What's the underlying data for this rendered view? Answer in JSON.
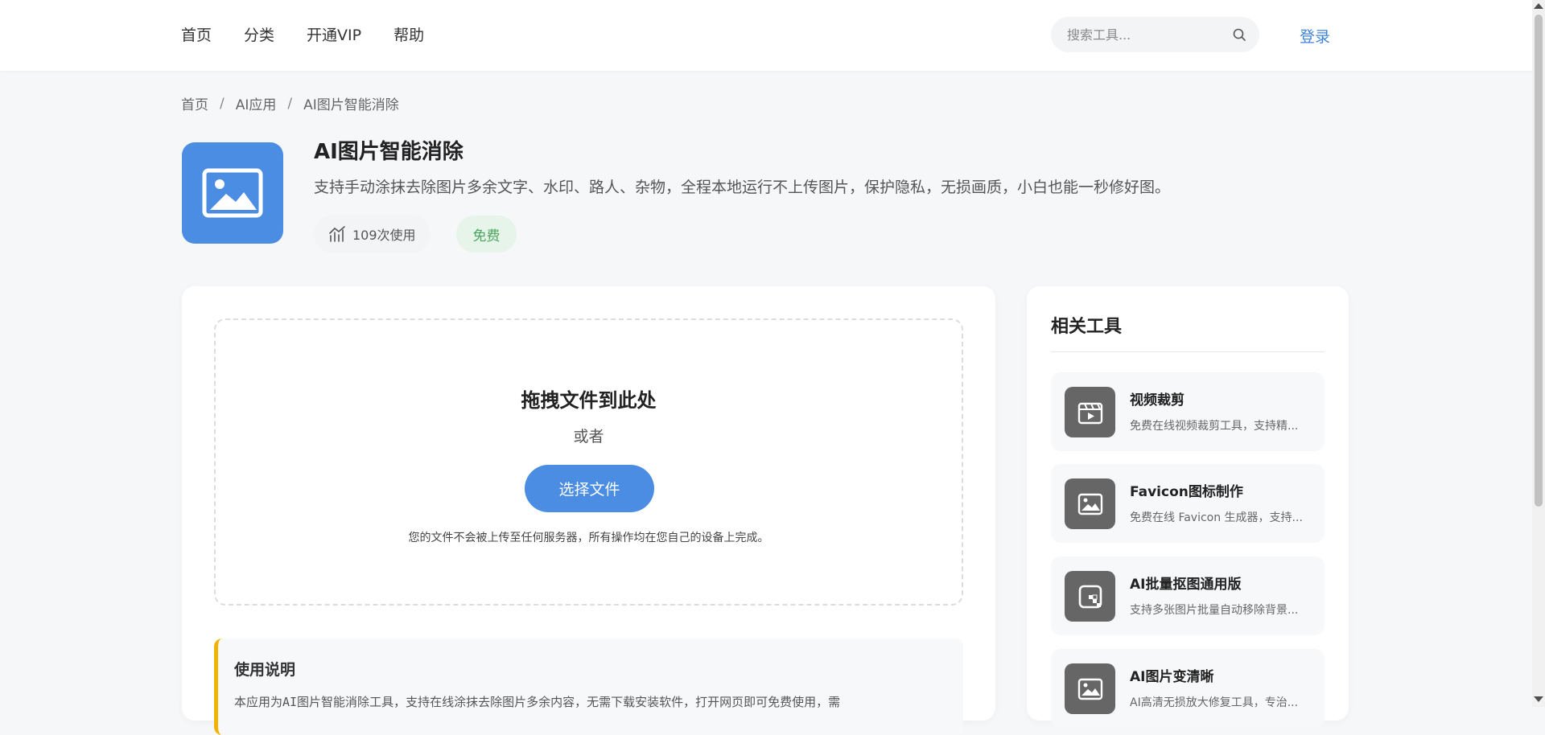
{
  "nav": {
    "items": [
      "首页",
      "分类",
      "开通VIP",
      "帮助"
    ]
  },
  "search": {
    "placeholder": "搜索工具..."
  },
  "login_label": "登录",
  "breadcrumb": [
    "首页",
    "AI应用",
    "AI图片智能消除"
  ],
  "app": {
    "title": "AI图片智能消除",
    "description": "支持手动涂抹去除图片多余文字、水印、路人、杂物，全程本地运行不上传图片，保护隐私，无损画质，小白也能一秒修好图。",
    "usage_count": "109次使用",
    "price_badge": "免费",
    "accent_color": "#4a8de3"
  },
  "dropzone": {
    "title": "拖拽文件到此处",
    "or": "或者",
    "button": "选择文件",
    "note": "您的文件不会被上传至任何服务器，所有操作均在您自己的设备上完成。"
  },
  "instructions": {
    "title": "使用说明",
    "text": "本应用为AI图片智能消除工具，支持在线涂抹去除图片多余内容，无需下载安装软件，打开网页即可免费使用，需"
  },
  "related": {
    "title": "相关工具",
    "items": [
      {
        "name": "视频裁剪",
        "desc": "免费在线视频裁剪工具，支持精...",
        "icon": "video-icon"
      },
      {
        "name": "Favicon图标制作",
        "desc": "免费在线 Favicon 生成器，支持...",
        "icon": "image-icon"
      },
      {
        "name": "AI批量抠图通用版",
        "desc": "支持多张图片批量自动移除背景...",
        "icon": "cutout-icon"
      },
      {
        "name": "AI图片变清晰",
        "desc": "AI高清无损放大修复工具，专治...",
        "icon": "image-icon"
      }
    ]
  }
}
